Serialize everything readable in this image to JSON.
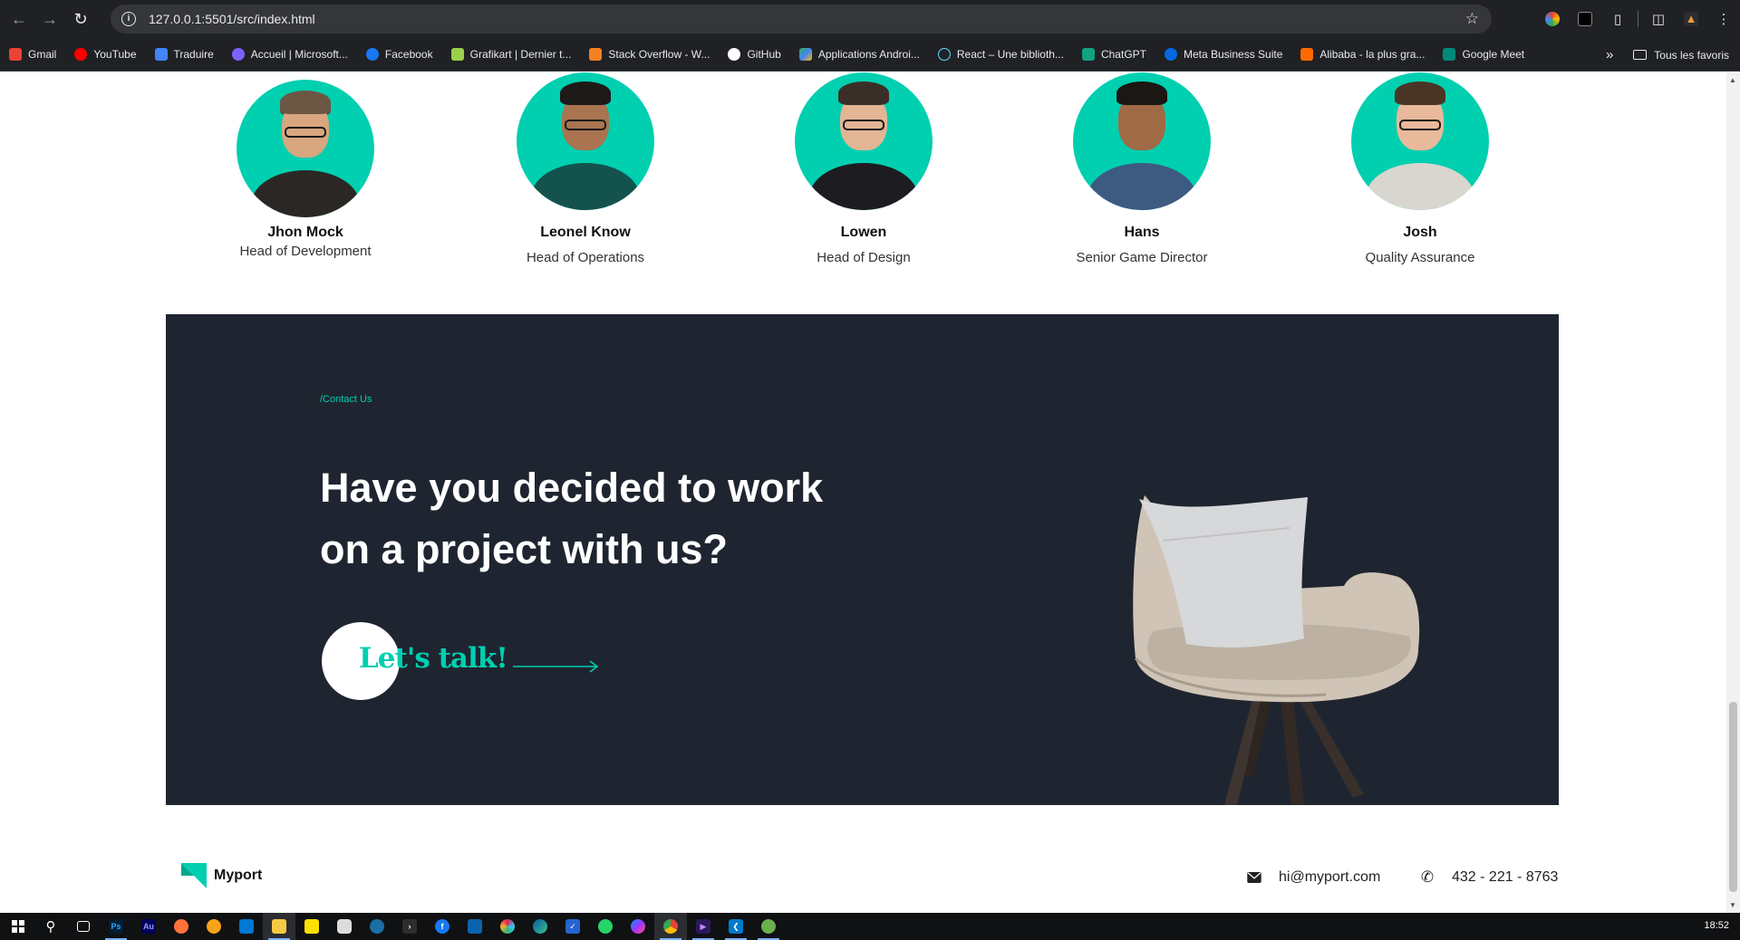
{
  "browser": {
    "url": "127.0.0.1:5501/src/index.html",
    "bookmarks": [
      {
        "label": "Gmail",
        "color": "#ea4335"
      },
      {
        "label": "YouTube",
        "color": "#ff0000"
      },
      {
        "label": "Traduire",
        "color": "#4285f4"
      },
      {
        "label": "Accueil | Microsoft...",
        "color": "#7b61ff"
      },
      {
        "label": "Facebook",
        "color": "#1877f2"
      },
      {
        "label": "Grafikart | Dernier t...",
        "color": "#9bd14a"
      },
      {
        "label": "Stack Overflow - W...",
        "color": "#f48024"
      },
      {
        "label": "GitHub",
        "color": "#ffffff"
      },
      {
        "label": "Applications Androi...",
        "color": "#34a853"
      },
      {
        "label": "React – Une biblioth...",
        "color": "#61dafb"
      },
      {
        "label": "ChatGPT",
        "color": "#10a37f"
      },
      {
        "label": "Meta Business Suite",
        "color": "#0668e1"
      },
      {
        "label": "Alibaba - la plus gra...",
        "color": "#ff6a00"
      },
      {
        "label": "Google Meet",
        "color": "#00897b"
      }
    ],
    "all_bookmarks_label": "Tous les favoris"
  },
  "team": [
    {
      "name": "Jhon Mock",
      "role": "Head of Development"
    },
    {
      "name": "Leonel Know",
      "role": "Head of Operations"
    },
    {
      "name": "Lowen",
      "role": "Head of Design"
    },
    {
      "name": "Hans",
      "role": "Senior Game Director"
    },
    {
      "name": "Josh",
      "role": "Quality Assurance"
    }
  ],
  "contact": {
    "tag": "/Contact Us",
    "heading": "Have you decided to work on a project with us?",
    "cta": "Let's talk!",
    "accent": "#00cfb0",
    "background": "#1f2530"
  },
  "footer": {
    "brand": "Myport",
    "email": "hi@myport.com",
    "phone": "432 - 221 - 8763"
  },
  "taskbar": {
    "apps": [
      "Ps",
      "Au"
    ],
    "clock": "18:52"
  }
}
